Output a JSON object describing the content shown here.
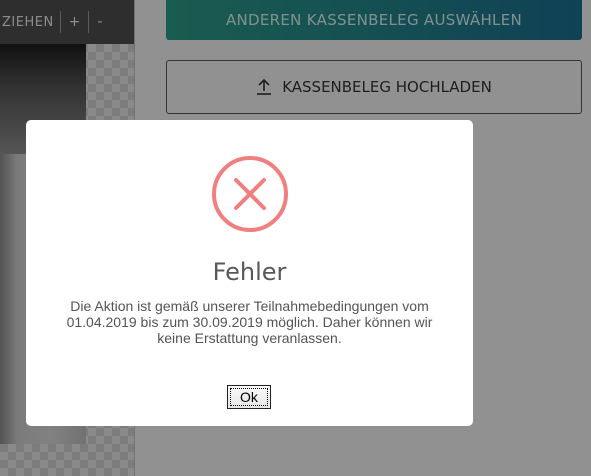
{
  "toolbar": {
    "label": "ZIEHEN",
    "plus": "+",
    "minus": "-"
  },
  "buttons": {
    "choose_other": "ANDEREN KASSENBELEG AUSWÄHLEN",
    "upload": "KASSENBELEG HOCHLADEN"
  },
  "dialog": {
    "title": "Fehler",
    "message": "Die Aktion ist gemäß unserer Teilnahmebedingungen vom 01.04.2019 bis zum 30.09.2019 möglich. Daher können wir keine Erstattung veranlassen.",
    "ok_label": "Ok"
  },
  "icons": {
    "error": "error-x-circle-icon",
    "upload": "upload-arrow-icon"
  },
  "colors": {
    "error": "#f08080",
    "primary_gradient_start": "#2a9a86",
    "primary_gradient_end": "#1b6e8e"
  }
}
